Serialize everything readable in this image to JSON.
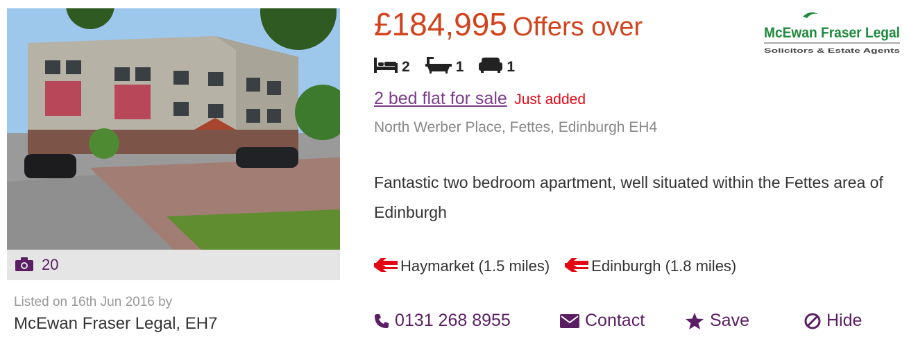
{
  "listing": {
    "photo": {
      "count": "20",
      "camera_icon": "camera-icon"
    },
    "listed_text": "Listed on 16th Jun 2016 by",
    "agent": "McEwan Fraser Legal, EH7",
    "price": {
      "amount": "£184,995",
      "qualifier": "Offers over"
    },
    "agent_logo": {
      "line1": "McEwan Fraser Legal",
      "line2": "Solicitors & Estate Agents"
    },
    "features": [
      {
        "icon": "bed-icon",
        "count": "2"
      },
      {
        "icon": "bath-icon",
        "count": "1"
      },
      {
        "icon": "sofa-icon",
        "count": "1"
      }
    ],
    "title": "2 bed flat for sale",
    "badge": "Just added",
    "address": "North Werber Place, Fettes, Edinburgh EH4",
    "description": "Fantastic two bedroom apartment, well situated within the Fettes area of Edinburgh",
    "stations": [
      {
        "icon": "national-rail-icon",
        "label": "Haymarket (1.5 miles)"
      },
      {
        "icon": "national-rail-icon",
        "label": "Edinburgh (1.8 miles)"
      }
    ],
    "actions": {
      "phone": "0131 268 8955",
      "contact": "Contact",
      "save": "Save",
      "hide": "Hide"
    }
  },
  "colors": {
    "price": "#d2431c",
    "purple": "#5a1e63",
    "link": "#7d3c8a",
    "badge": "#e30613",
    "rail": "#e30613",
    "logo_green": "#1e8a3c"
  }
}
